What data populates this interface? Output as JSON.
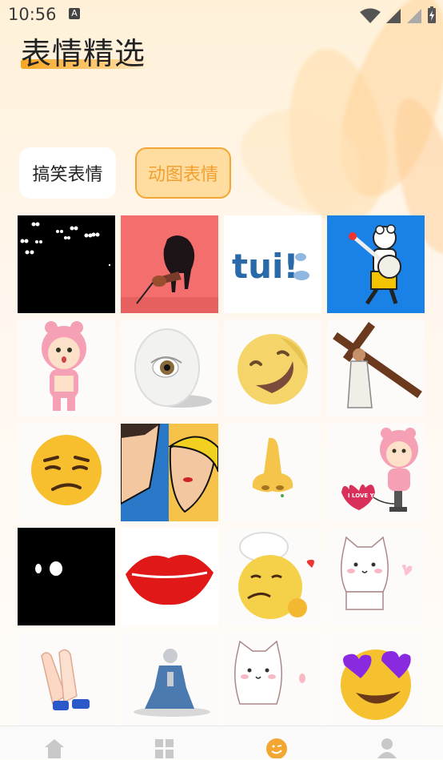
{
  "status_bar": {
    "time": "10:56",
    "notification_icon": "A"
  },
  "page_title": "表情精选",
  "tabs": [
    {
      "label": "搞笑表情",
      "active": false
    },
    {
      "label": "动图表情",
      "active": true
    }
  ],
  "colors": {
    "accent": "#f4a632",
    "active_tab_bg": "#ffdca0",
    "background": "#fff6ea"
  },
  "stickers": [
    {
      "name": "eyes-in-dark"
    },
    {
      "name": "heart-guitar"
    },
    {
      "name": "tui-text"
    },
    {
      "name": "bear-banjo"
    },
    {
      "name": "pink-bear-doll"
    },
    {
      "name": "egg-eye"
    },
    {
      "name": "smirk-moon-face"
    },
    {
      "name": "cross-bearer"
    },
    {
      "name": "unamused-emoji"
    },
    {
      "name": "pop-art-couple"
    },
    {
      "name": "nose"
    },
    {
      "name": "pink-bear-love-pump"
    },
    {
      "name": "black-dots"
    },
    {
      "name": "red-lips"
    },
    {
      "name": "chef-kiss-emoji"
    },
    {
      "name": "white-cat-heart"
    },
    {
      "name": "clapping-hands"
    },
    {
      "name": "praying-figure"
    },
    {
      "name": "pixel-cat"
    },
    {
      "name": "heart-eyes-emoji"
    }
  ],
  "sticker_texts": {
    "tui": "tui!",
    "i_love_you": "I LOVE YOU"
  },
  "bottom_nav": [
    {
      "icon": "home-icon",
      "active": false
    },
    {
      "icon": "grid-icon",
      "active": false
    },
    {
      "icon": "smile-icon",
      "active": true
    },
    {
      "icon": "person-icon",
      "active": false
    }
  ]
}
